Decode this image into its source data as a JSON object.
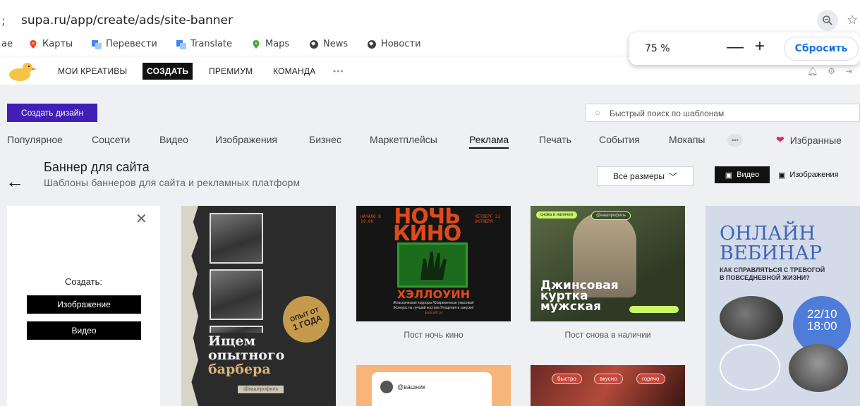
{
  "browser": {
    "url_prefix": ";",
    "url": "supa.ru/app/create/ads/site-banner",
    "bookmarks": [
      {
        "label": "ае",
        "icon": "none"
      },
      {
        "label": "Карты",
        "icon": "maps-pin-icon"
      },
      {
        "label": "Перевести",
        "icon": "translate-icon"
      },
      {
        "label": "Translate",
        "icon": "translate-icon"
      },
      {
        "label": "Maps",
        "icon": "maps-pin-icon"
      },
      {
        "label": "News",
        "icon": "globe-icon"
      },
      {
        "label": "Новости",
        "icon": "globe-icon"
      }
    ],
    "zoom": {
      "level": "75 %",
      "minus": "—",
      "plus": "+",
      "reset_label": "Сбросить"
    }
  },
  "header": {
    "nav": [
      "МОИ КРЕАТИВЫ",
      "СОЗДАТЬ",
      "ПРЕМИУМ",
      "КОМАНДА",
      "•••"
    ],
    "active": "СОЗДАТЬ"
  },
  "toolbar": {
    "create_design_label": "Создать дизайн",
    "search_placeholder": "Быстрый поиск по шаблонам"
  },
  "categories": {
    "items": [
      "Популярное",
      "Соцсети",
      "Видео",
      "Изображения",
      "Бизнес",
      "Маркетплейсы",
      "Реклама",
      "Печать",
      "События",
      "Мокапы"
    ],
    "more": "•••",
    "active": "Реклама",
    "favorites_label": "Избранные"
  },
  "page": {
    "title": "Баннер для сайта",
    "subtitle": "Шаблоны баннеров для сайта и рекламных платформ",
    "sizes_label": "Все размеры",
    "video_label": "Видео",
    "images_label": "Изображения"
  },
  "create_panel": {
    "label": "Создать:",
    "image_button": "Изображение",
    "video_button": "Видео"
  },
  "cards": {
    "barber": {
      "line1": "Ищем",
      "line2": "опытного",
      "line3": "барбера",
      "badge1": "ОПЫТ ОТ",
      "badge2": "1 ГОДА",
      "handle": "@вашпрофиль"
    },
    "night": {
      "title1": "НОЧЬ",
      "title2": "КИНО",
      "left_small": "НАЧАЛО В 19:00",
      "right_small": "ЧЕТВЕРГ 31 ОКТЯБРЯ",
      "halloween": "ХЭЛЛОУИН",
      "fine1": "/Классические хорроры /Современные ужастики/",
      "fine2": "/Конкурс на лучший костюм /Угощения и закуски/",
      "site": "вашсайт.ру",
      "caption": "Пост ночь кино"
    },
    "jeans": {
      "pill1": "снова в наличии",
      "pill2": "@вашпрофиль",
      "line1": "Джинсовая",
      "line2": "куртка",
      "line3": "мужская",
      "caption": "Пост снова в наличии"
    },
    "webinar": {
      "line1": "ОНЛАЙН",
      "line2": "ВЕБИНАР",
      "q1": "КАК СПРАВЛЯТЬСЯ С ТРЕВОГОЙ",
      "q2": "В ПОВСЕДНЕВНОЙ ЖИЗНИ?",
      "date": "22/10",
      "time": "18:00"
    },
    "social": {
      "handle": "@вашник"
    },
    "food": {
      "tags": [
        "быстро",
        "вкусно",
        "горячо"
      ]
    }
  },
  "colors": {
    "accent": "#3f1fb8",
    "active_nav": "#111111",
    "zoom_reset": "#1a73e8",
    "heart": "#e0245e"
  }
}
